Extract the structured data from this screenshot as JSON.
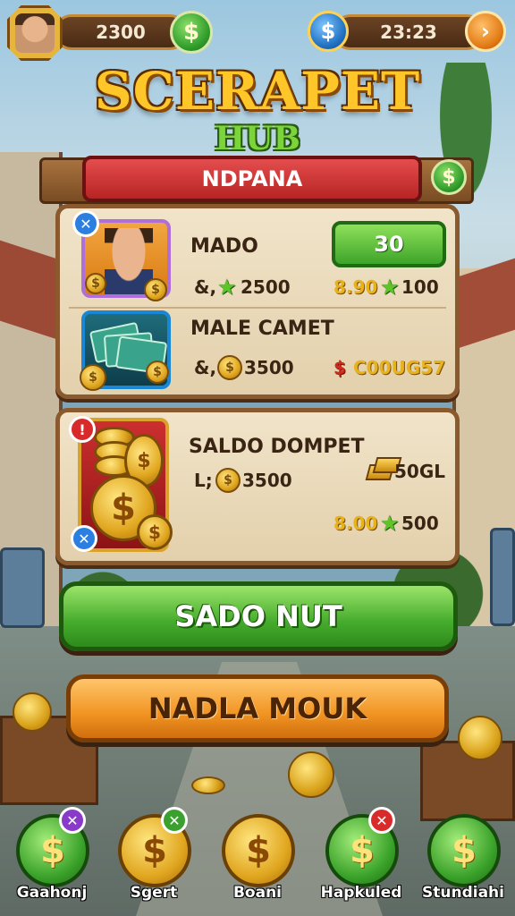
{
  "header": {
    "coins": "2300",
    "coin_icon": "$",
    "gem_icon": "$",
    "timer": "23:23",
    "arrow_icon": "›"
  },
  "logo": {
    "title": "SCERAPET",
    "subtitle": "HUB"
  },
  "panel": {
    "banner": "NDPANA",
    "banner_coin": "$"
  },
  "items": [
    {
      "title": "MADO",
      "value_prefix": "&,",
      "value": "2500",
      "button_label": "30",
      "price_text": "8.90",
      "price_stars": "100",
      "badge": "✕"
    },
    {
      "title": "MALE CAMET",
      "value_prefix": "&,",
      "value": "3500",
      "price_symbol": "$",
      "price_text": "C00UG57"
    }
  ],
  "wallet": {
    "title": "SALDO DOMPET",
    "value_prefix": "L;",
    "value": "3500",
    "gold_amount": "50GL",
    "price_text": "8.00",
    "price_stars": "500",
    "badge_top": "!",
    "badge_bottom": "✕"
  },
  "buttons": {
    "primary": "SADO NUT",
    "secondary": "NADLA MOUK"
  },
  "nav": [
    {
      "label": "Gaahonj",
      "symbol": "$",
      "badge": "✕"
    },
    {
      "label": "Sgert",
      "symbol": "$",
      "badge": "✕"
    },
    {
      "label": "Boani",
      "symbol": "$"
    },
    {
      "label": "Hapkuled",
      "symbol": "$",
      "badge": "✕"
    },
    {
      "label": "Stundiahi",
      "symbol": "$"
    }
  ],
  "colors": {
    "banner_red": "#d83a3a",
    "primary_green": "#44ab2c",
    "secondary_orange": "#f19322",
    "gold": "#e0a51e",
    "card_parchment": "#ecdcbc"
  }
}
